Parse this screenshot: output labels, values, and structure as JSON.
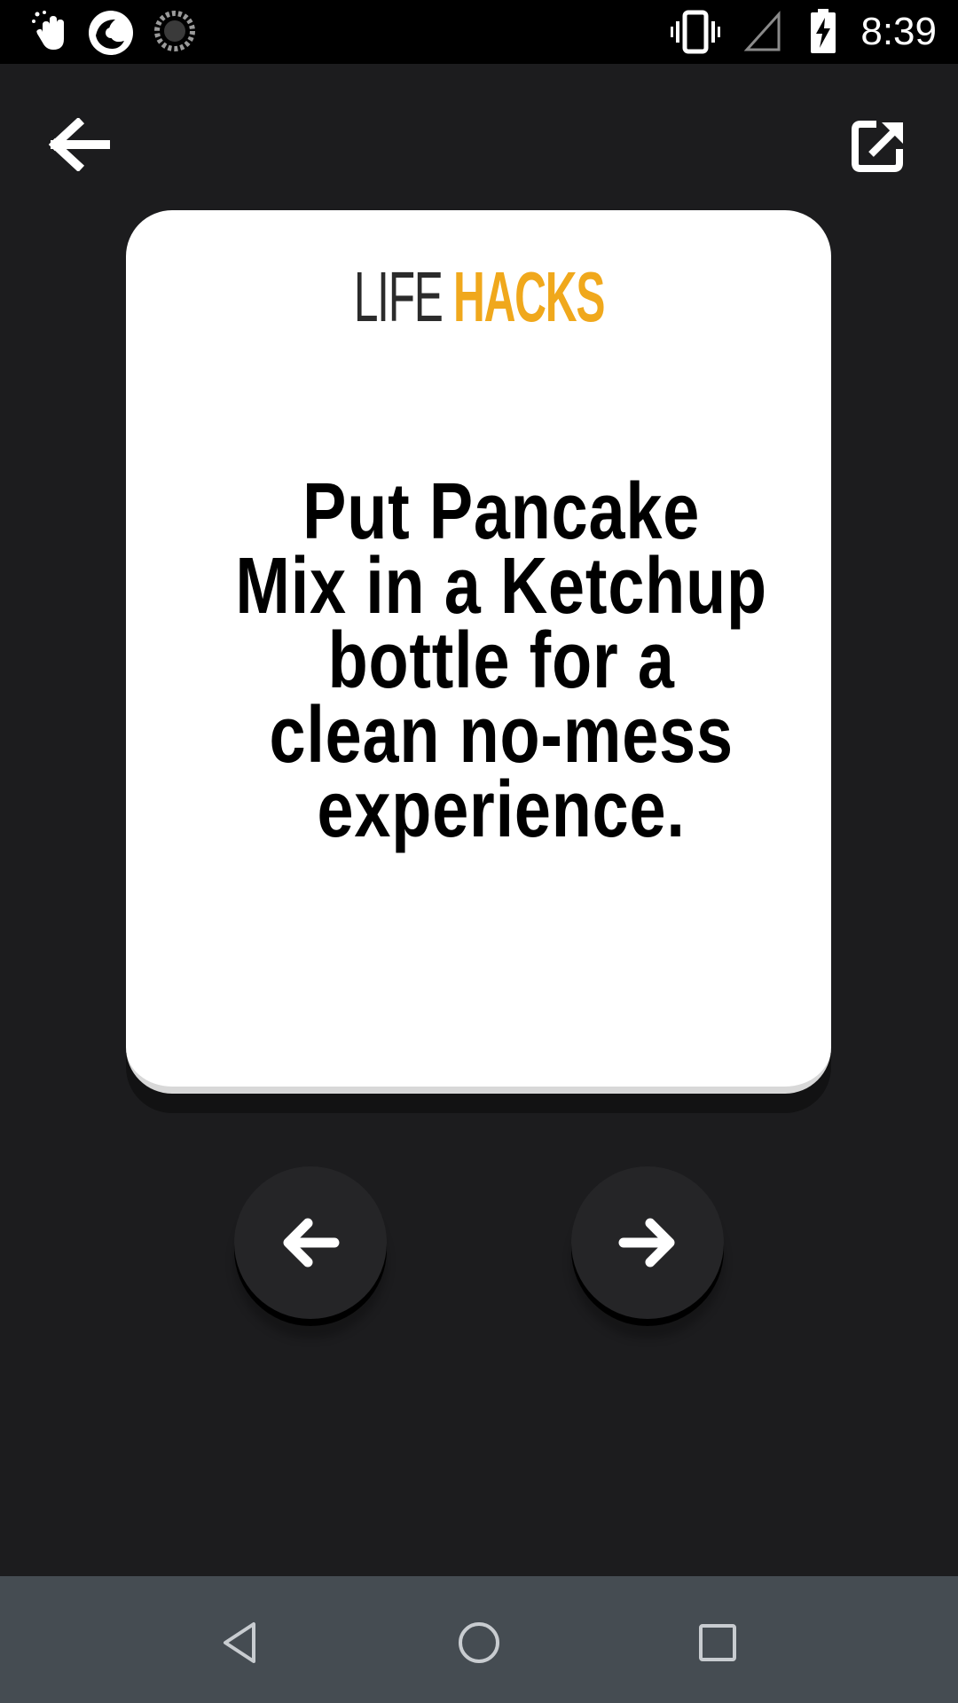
{
  "status_bar": {
    "time": "8:39",
    "icons": [
      "hand-wave-icon",
      "app-swirl-icon",
      "loading-spinner-icon",
      "vibrate-icon",
      "signal-icon",
      "battery-charging-icon"
    ]
  },
  "app_bar": {
    "back_icon": "arrow-left-icon",
    "share_icon": "share-external-icon"
  },
  "card": {
    "brand_part1": "LIFE",
    "brand_part2": "HACKS",
    "hack_lines": [
      "Put Pancake",
      "Mix in a Ketchup",
      "bottle for a",
      "clean no-mess",
      "experience."
    ]
  },
  "navigation": {
    "prev_icon": "arrow-left-icon",
    "next_icon": "arrow-right-icon"
  },
  "system_nav": {
    "icons": [
      "triangle-back-icon",
      "circle-home-icon",
      "square-recents-icon"
    ]
  },
  "colors": {
    "background": "#1c1c1e",
    "card": "#ffffff",
    "brand_accent": "#f0a81c",
    "brand_dark": "#2b2b2b",
    "nav_bar": "#454c52",
    "button": "#252527"
  }
}
